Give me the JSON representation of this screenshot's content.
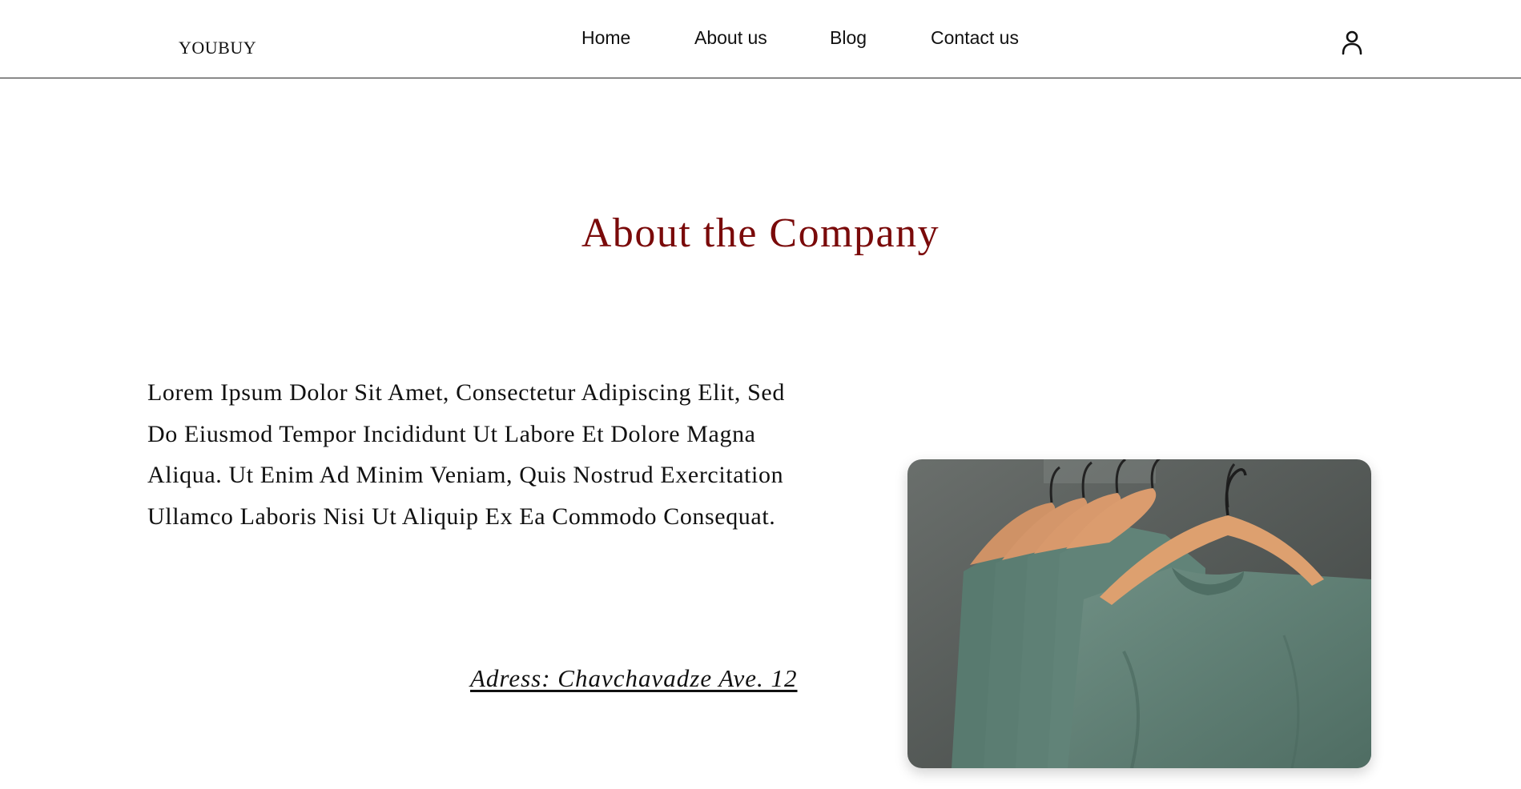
{
  "header": {
    "logo": "YOUBUY",
    "nav": {
      "home": "Home",
      "about": "About us",
      "blog": "Blog",
      "contact": "Contact us"
    },
    "user_icon": "user-icon"
  },
  "main": {
    "title": "About the Company",
    "intro": "Lorem Ipsum Dolor Sit Amet, Consectetur Adipiscing Elit, Sed Do Eiusmod Tempor Incididunt Ut Labore Et Dolore Magna Aliqua. Ut Enim Ad Minim Veniam, Quis Nostrud Exercitation Ullamco Laboris Nisi Ut Aliquip Ex Ea Commodo Consequat.",
    "address": "Adress: Chavchavadze Ave. 12",
    "image_alt": "Green t-shirts on wooden hangers"
  },
  "colors": {
    "title": "#7a0a0a",
    "shirt": "#5e7f74",
    "hanger": "#d89a6c",
    "backdrop": "#5a5f5c"
  }
}
